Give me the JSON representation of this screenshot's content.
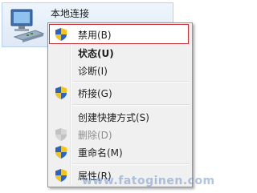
{
  "adapter": {
    "name": "本地连接",
    "icon": "network-adapter-icon"
  },
  "menu": {
    "items": [
      {
        "label": "禁用(B)",
        "icon": "uac-shield-icon"
      },
      {
        "label": "状态(U)"
      },
      {
        "label": "诊断(I)"
      },
      {
        "label": "桥接(G)",
        "icon": "uac-shield-icon"
      },
      {
        "label": "创建快捷方式(S)"
      },
      {
        "label": "删除(D)",
        "icon": "uac-shield-icon",
        "disabled": true
      },
      {
        "label": "重命名(M)",
        "icon": "uac-shield-icon"
      },
      {
        "label": "属性(R)",
        "icon": "uac-shield-icon"
      }
    ]
  },
  "watermark": "www.fatoginen.com",
  "colors": {
    "highlight_border": "#c8303a",
    "menu_bg": "#f0f0f0",
    "tile_bg": "#e6eef8"
  }
}
